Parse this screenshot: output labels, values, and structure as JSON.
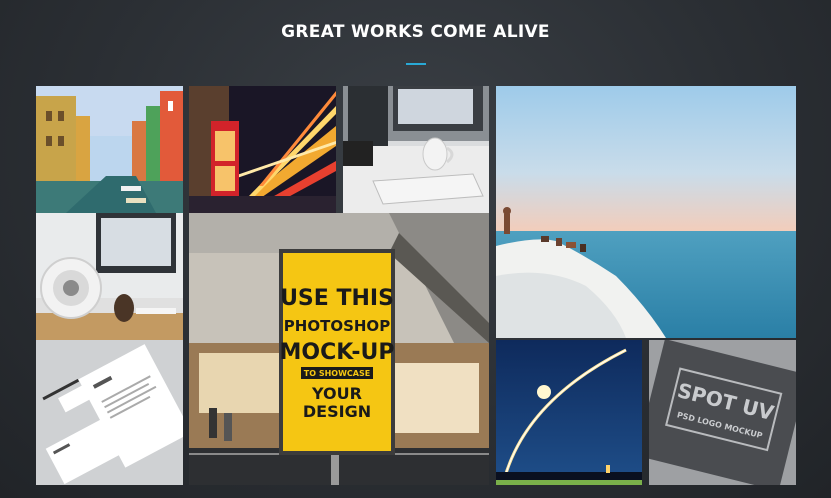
{
  "section": {
    "title": "GREAT WORKS COME ALIVE",
    "accent_color": "#29a9d6"
  },
  "poster": {
    "line1": "USE THIS",
    "line2": "PHOTOSHOP",
    "line3": "MOCK-UP",
    "line4": "TO SHOWCASE",
    "line5": "YOUR",
    "line6": "DESIGN"
  },
  "stamp": {
    "line1": "SPOT UV",
    "line2": "PSD LOGO MOCKUP"
  }
}
